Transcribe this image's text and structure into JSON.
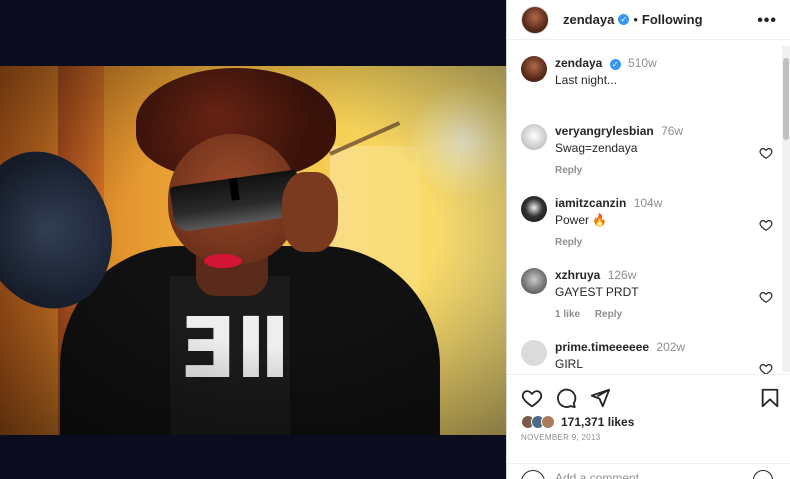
{
  "post": {
    "author": "zendaya",
    "follow_separator": "•",
    "follow_label": "Following",
    "more_label": "•••"
  },
  "caption": {
    "username": "zendaya",
    "time": "510w",
    "text": "Last night..."
  },
  "comments": [
    {
      "username": "veryangrylesbian",
      "time": "76w",
      "text": "Swag=zendaya",
      "reply_label": "Reply",
      "likes_label": ""
    },
    {
      "username": "iamitzcanzin",
      "time": "104w",
      "text": "Power 🔥",
      "reply_label": "Reply",
      "likes_label": ""
    },
    {
      "username": "xzhruya",
      "time": "126w",
      "text": "GAYEST PRDT",
      "reply_label": "Reply",
      "likes_label": "1 like"
    },
    {
      "username": "prime.timeeeeee",
      "time": "202w",
      "text": "GIRL",
      "reply_label": "",
      "likes_label": ""
    }
  ],
  "engagement": {
    "likes": "171,371 likes",
    "date": "NOVEMBER 9, 2013"
  },
  "composer": {
    "placeholder": "Add a comment..."
  },
  "icons": [
    "heart-icon",
    "comment-icon",
    "share-icon",
    "bookmark-icon",
    "more-icon",
    "verified-icon",
    "emoji-icon"
  ],
  "colors": {
    "verified": "#3897f0",
    "text": "#262626",
    "muted": "#8e8e8e"
  }
}
